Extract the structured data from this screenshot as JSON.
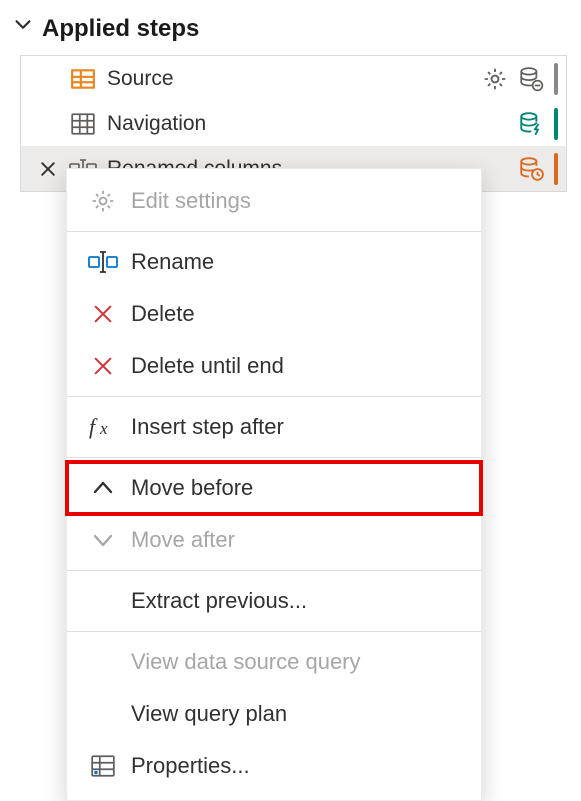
{
  "section": {
    "title": "Applied steps"
  },
  "steps": [
    {
      "label": "Source"
    },
    {
      "label": "Navigation"
    },
    {
      "label": "Renamed columns"
    }
  ],
  "menu": {
    "edit_settings": "Edit settings",
    "rename": "Rename",
    "delete": "Delete",
    "delete_until_end": "Delete until end",
    "insert_step_after": "Insert step after",
    "move_before": "Move before",
    "move_after": "Move after",
    "extract_previous": "Extract previous...",
    "view_data_source_query": "View data source query",
    "view_query_plan": "View query plan",
    "properties": "Properties..."
  },
  "colors": {
    "accent_orange": "#f2a93b",
    "stripe_gray": "#8a8886",
    "stripe_teal": "#008575",
    "stripe_orange": "#d86b1f"
  }
}
